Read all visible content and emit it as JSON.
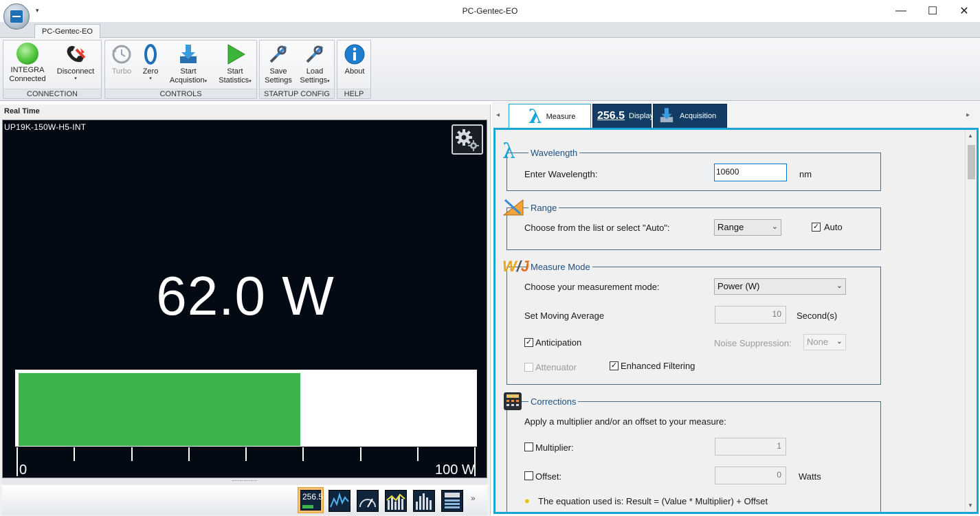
{
  "window": {
    "title": "PC-Gentec-EO",
    "minimize": "—",
    "maximize": "☐",
    "close": "✕",
    "qa_arrow": "▾"
  },
  "ribbon": {
    "tab": "PC-Gentec-EO",
    "groups": {
      "connection": {
        "label": "CONNECTION",
        "integra_line1": "INTEGRA",
        "integra_line2": "Connected",
        "disconnect": "Disconnect"
      },
      "controls": {
        "label": "CONTROLS",
        "turbo": "Turbo",
        "zero": "Zero",
        "start_acq_line1": "Start",
        "start_acq_line2": "Acquistion",
        "start_stats_line1": "Start",
        "start_stats_line2": "Statistics"
      },
      "startup": {
        "label": "STARTUP CONFIG",
        "save_line1": "Save",
        "save_line2": "Settings",
        "load_line1": "Load",
        "load_line2": "Settings"
      },
      "help": {
        "label": "HELP",
        "about": "About"
      }
    },
    "caret": "▾"
  },
  "realtime": {
    "label": "Real Time",
    "detector": "UP19K-150W-H5-INT",
    "reading": "62.0 W",
    "bar_fraction": 0.62,
    "scale_min": "0",
    "scale_max": "100 W",
    "overflow_chevron": "»"
  },
  "tabs": {
    "left_arrow": "◂",
    "right_arrow": "▸",
    "measure": "Measure",
    "display": "Display",
    "display_icon": "256.5",
    "acquisition": "Acquisition"
  },
  "wavelength": {
    "legend": "Wavelength",
    "label": "Enter Wavelength:",
    "value": "10600",
    "unit": "nm"
  },
  "range": {
    "legend": "Range",
    "label": "Choose from the list or select \"Auto\":",
    "selected": "Range",
    "auto_label": "Auto",
    "auto_checked": "✓"
  },
  "measure_mode": {
    "legend": "Measure Mode",
    "mode_label": "Choose your measurement mode:",
    "mode_selected": "Power (W)",
    "moving_avg_label": "Set Moving Average",
    "moving_avg_value": "10",
    "moving_avg_unit": "Second(s)",
    "anticipation_label": "Anticipation",
    "anticipation_checked": "✓",
    "noise_label": "Noise Suppression:",
    "noise_selected": "None",
    "attenuator_label": "Attenuator",
    "enhanced_label": "Enhanced Filtering",
    "enhanced_checked": "✓"
  },
  "corrections": {
    "legend": "Corrections",
    "intro": "Apply a multiplier and/or an offset to your measure:",
    "multiplier_label": "Multiplier:",
    "multiplier_value": "1",
    "offset_label": "Offset:",
    "offset_value": "0",
    "offset_unit": "Watts",
    "equation": "The equation used is: Result = (Value * Multiplier) + Offset"
  },
  "scroll": {
    "up": "▲",
    "down": "▼"
  },
  "colors": {
    "accent": "#1aa5d6",
    "bar_green": "#3cb44b",
    "display_bg": "#030a14",
    "tab_dark": "#123c63"
  }
}
